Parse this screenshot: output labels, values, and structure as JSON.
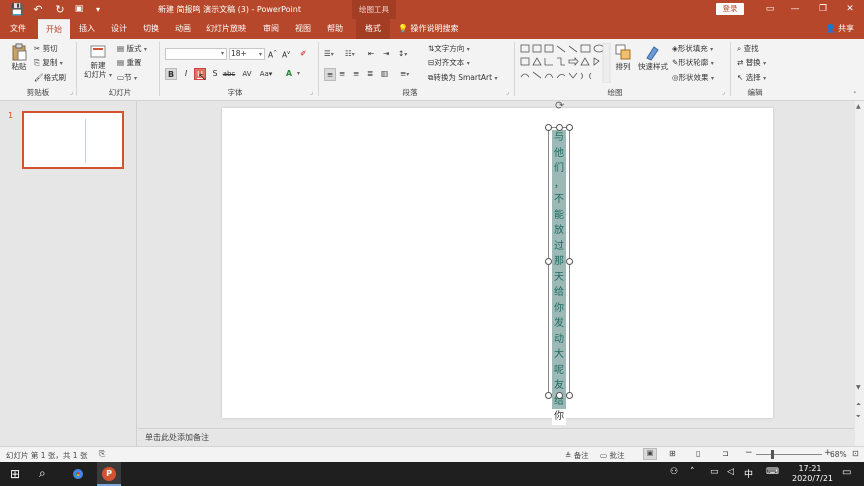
{
  "titlebar": {
    "title": "新建 简报鸣 演示文稿 (3)  -  PowerPoint",
    "drawing_tools": "绘图工具",
    "login": "登录",
    "qa_save": "💾",
    "qa_undo": "↶",
    "qa_redo": "↻",
    "qa_custom": "▾"
  },
  "tabs": [
    {
      "label": "文件"
    },
    {
      "label": "开始"
    },
    {
      "label": "插入"
    },
    {
      "label": "设计"
    },
    {
      "label": "切换"
    },
    {
      "label": "动画"
    },
    {
      "label": "幻灯片放映"
    },
    {
      "label": "审阅"
    },
    {
      "label": "视图"
    },
    {
      "label": "帮助"
    },
    {
      "label": "格式"
    }
  ],
  "search_tab": "操作说明搜索",
  "share": "共享",
  "ribbon": {
    "clipboard": {
      "paste": "粘贴",
      "cut": "剪切",
      "copy": "复制",
      "format_painter": "格式刷",
      "label": "剪贴板"
    },
    "slides": {
      "new_slide": "新建\n幻灯片",
      "layout": "版式",
      "reset": "重置",
      "section": "节",
      "label": "幻灯片"
    },
    "font": {
      "font_name": "",
      "font_size": "18+",
      "label": "字体"
    },
    "paragraph": {
      "text_direction": "文字方向",
      "align_text": "对齐文本",
      "smartart": "转换为 SmartArt",
      "label": "段落"
    },
    "drawing": {
      "arrange": "排列",
      "quick_styles": "快速样式",
      "shape_fill": "形状填充",
      "shape_outline": "形状轮廓",
      "shape_effects": "形状效果",
      "label": "绘图"
    },
    "editing": {
      "find": "查找",
      "replace": "替换",
      "select": "选择",
      "label": "编辑"
    }
  },
  "thumbnail": {
    "number": "1"
  },
  "slide": {
    "vertical_text": [
      "与",
      "他",
      "们",
      "，",
      "不",
      "能",
      "放",
      "过",
      "那",
      "天",
      "给",
      "你",
      "发",
      "动",
      "大",
      "呢",
      "友",
      "给",
      "你"
    ]
  },
  "notes_placeholder": "单击此处添加备注",
  "statusbar": {
    "slide_info": "幻灯片 第 1 张，共 1 张",
    "notes": "备注",
    "comments": "批注",
    "zoom": "68%"
  },
  "taskbar": {
    "time": "17:21",
    "date": "2020/7/21",
    "ime": "中"
  },
  "colors": {
    "accent": "#b7472a",
    "selection_fill": "#9cb9b6",
    "text": "#1f6b63"
  }
}
